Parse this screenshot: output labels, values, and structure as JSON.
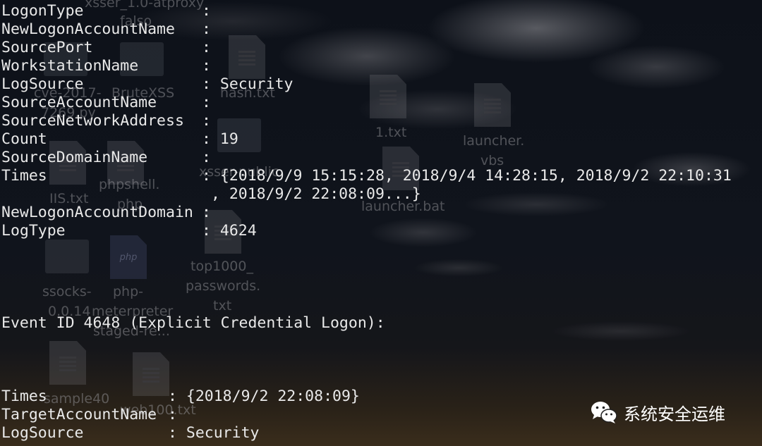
{
  "desktop": {
    "labels": [
      "xsser_1.0-atproxy",
      "falso",
      "cve-2017-",
      "7269.py",
      "BruteXSS",
      "hash.txt",
      "1.txt",
      "launcher.",
      "vbs",
      "xsser-public",
      "IIS.txt",
      "phpshell.",
      "php",
      "launcher.bat",
      "top1000_",
      "passwords.",
      "txt",
      "ssocks-",
      "0.0.14",
      "php-",
      "meterpreter",
      "staged-re...",
      "sample40",
      "web100.txt"
    ],
    "php_icon_text": "php"
  },
  "terminal": {
    "block1": [
      {
        "key": "LogonType",
        "sep": ":",
        "value": ""
      },
      {
        "key": "NewLogonAccountName",
        "sep": ":",
        "value": ""
      },
      {
        "key": "SourcePort",
        "sep": ":",
        "value": ""
      },
      {
        "key": "WorkstationName",
        "sep": ":",
        "value": ""
      },
      {
        "key": "LogSource",
        "sep": ":",
        "value": "Security"
      },
      {
        "key": "SourceAccountName",
        "sep": ":",
        "value": ""
      },
      {
        "key": "SourceNetworkAddress",
        "sep": ":",
        "value": ""
      },
      {
        "key": "Count",
        "sep": ":",
        "value": "19"
      },
      {
        "key": "SourceDomainName",
        "sep": ":",
        "value": ""
      },
      {
        "key": "Times",
        "sep": ":",
        "value": "{2018/9/9 15:15:28, 2018/9/4 14:28:15, 2018/9/2 22:10:31"
      },
      {
        "key": "",
        "sep": "",
        "value": ", 2018/9/2 22:08:09...}"
      },
      {
        "key": "NewLogonAccountDomain",
        "sep": ":",
        "value": ""
      },
      {
        "key": "LogType",
        "sep": ":",
        "value": "4624"
      }
    ],
    "heading": "Event ID 4648 (Explicit Credential Logon):",
    "block2": [
      {
        "key": "Times",
        "sep": ":",
        "value": "{2018/9/2 22:08:09}"
      },
      {
        "key": "TargetAccountName",
        "sep": ":",
        "value": ""
      },
      {
        "key": "LogSource",
        "sep": ":",
        "value": "Security"
      }
    ]
  },
  "watermark": {
    "text": "系统安全运维",
    "icon": "wechat-icon"
  },
  "colors": {
    "terminal_text": "#e9e9e9",
    "background": "#0d1119"
  }
}
